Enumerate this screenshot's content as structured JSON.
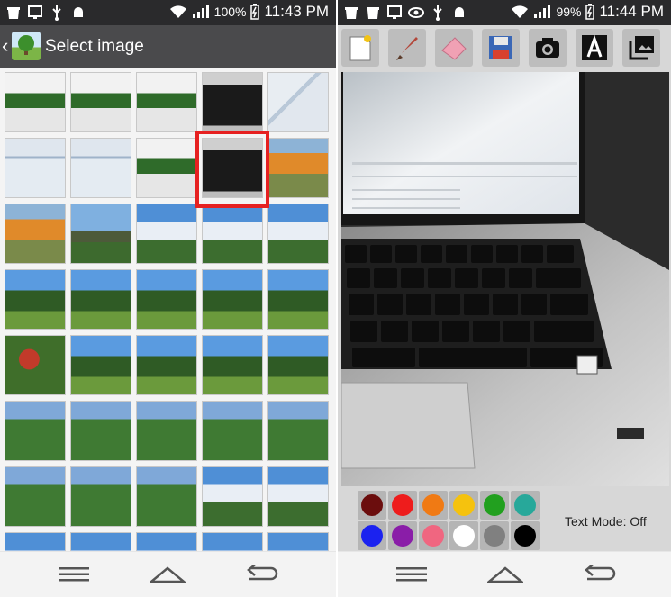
{
  "left_screen": {
    "status": {
      "battery": "100%",
      "time": "11:43 PM"
    },
    "appbar": {
      "title": "Select image",
      "back_icon": "chevron-left-icon"
    },
    "grid": {
      "rows": [
        [
          "plant",
          "plant",
          "plant",
          "laptop",
          "map"
        ],
        [
          "screen",
          "screen",
          "plant",
          "laptop",
          "pumpkins"
        ],
        [
          "pumpkins",
          "farm",
          "sky",
          "sky",
          "sky"
        ],
        [
          "orchard",
          "orchard",
          "orchard",
          "orchard",
          "orchard"
        ],
        [
          "apples",
          "orchard",
          "orchard",
          "orchard",
          "orchard"
        ],
        [
          "kids",
          "kids",
          "kids",
          "kids",
          "kids"
        ],
        [
          "kids",
          "kids",
          "kids",
          "sky",
          "sky"
        ],
        [
          "sky",
          "sky",
          "sky",
          "sky",
          "sky"
        ]
      ],
      "selected": {
        "row": 1,
        "col": 3
      }
    }
  },
  "right_screen": {
    "status": {
      "battery": "99%",
      "time": "11:44 PM"
    },
    "tools": [
      {
        "name": "new-canvas-icon"
      },
      {
        "name": "brush-icon"
      },
      {
        "name": "eraser-icon"
      },
      {
        "name": "save-icon"
      },
      {
        "name": "camera-icon"
      },
      {
        "name": "text-icon",
        "glyph": "A"
      },
      {
        "name": "gallery-icon"
      }
    ],
    "palette": [
      "#6b0d0d",
      "#ee1c1c",
      "#f07a14",
      "#f5c20e",
      "#22a01f",
      "#27a89a",
      "#1b22f0",
      "#8a1da8",
      "#f06680",
      "#ffffff",
      "#808080",
      "#000000"
    ],
    "text_mode_label": "Text Mode: Off"
  },
  "navbar": {
    "icons": [
      "menu-icon",
      "home-icon",
      "back-icon"
    ]
  }
}
